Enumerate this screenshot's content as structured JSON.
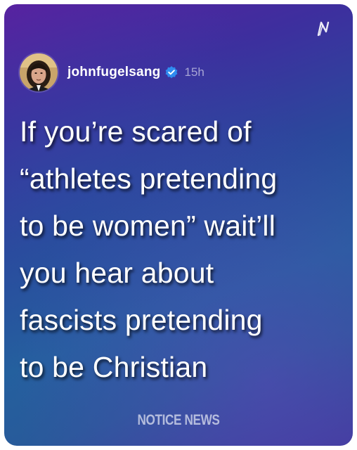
{
  "post": {
    "username": "johnfugelsang",
    "timestamp": "15h",
    "text": "If you’re scared of\n“athletes pretending\nto be women” wait’ll\nyou hear about\nfascists pretending\nto be Christian"
  },
  "icons": {
    "logo": "threads-n-logo",
    "verified": "verified-badge-icon",
    "avatar": "avatar"
  },
  "watermark": "NOTICE NEWS",
  "colors": {
    "gradient_top": "#5a1fa0",
    "gradient_mid": "#24609e",
    "verified_blue": "#2f8cf0",
    "text": "#ffffff"
  }
}
